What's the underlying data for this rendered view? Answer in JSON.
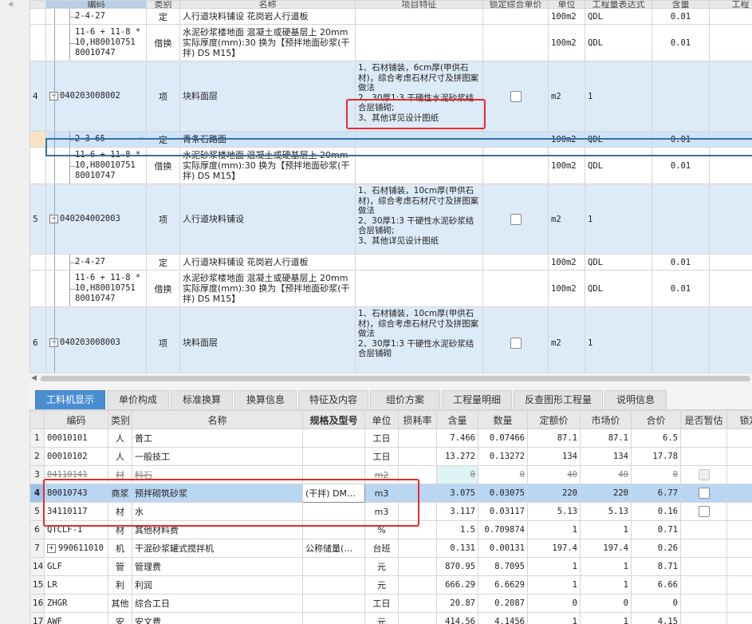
{
  "left_bar": {
    "collapse_icon": "«"
  },
  "top_grid": {
    "headers": [
      "编码",
      "类别",
      "名称",
      "项目特征",
      "锁定综合单价",
      "单位",
      "工程量表达式",
      "含量",
      "工程"
    ],
    "rows": [
      {
        "row": "",
        "code": "2-4-27",
        "type": "定",
        "name": "人行道块料铺设 花岗岩人行道板",
        "feature": "",
        "unit": "100m2",
        "expr": "QDL",
        "qty": "0.01",
        "kind": "child"
      },
      {
        "row": "",
        "code": "11-6 + 11-8 * 10,H80010751 80010747",
        "type": "借换",
        "name": "水泥砂浆楼地面 混凝土或硬基层上 20mm 实际厚度(mm):30 换为【预拌地面砂浆(干拌) DS M15】",
        "feature": "",
        "unit": "100m2",
        "expr": "QDL",
        "qty": "0.01",
        "kind": "child"
      },
      {
        "row": "4",
        "code": "040203008002",
        "type": "项",
        "name": "块料面层",
        "feature": "1、石材铺装，6cm厚(甲供石材)，综合考虑石材尺寸及拼图案做法\n2、30厚1:3 干硬性水泥砂浆结合层铺砌;\n3、其他详见设计图纸",
        "unit": "m2",
        "expr": "1",
        "qty": "",
        "kind": "item"
      },
      {
        "row": "",
        "code": "2-3-65",
        "type": "定",
        "name": "青条石路面",
        "feature": "",
        "unit": "100m2",
        "expr": "QDL",
        "qty": "0.01",
        "kind": "current"
      },
      {
        "row": "",
        "code": "11-6 + 11-8 * 10,H80010751 80010747",
        "type": "借换",
        "name": "水泥砂浆楼地面 混凝土或硬基层上 20mm 实际厚度(mm):30 换为【预拌地面砂浆(干拌) DS M15】",
        "feature": "",
        "unit": "100m2",
        "expr": "QDL",
        "qty": "0.01",
        "kind": "child"
      },
      {
        "row": "5",
        "code": "040204002003",
        "type": "项",
        "name": "人行道块料铺设",
        "feature": "1、石材铺装，10cm厚(甲供石材)，综合考虑石材尺寸及拼图案做法\n2、30厚1:3 干硬性水泥砂浆结合层铺砌;\n3、其他详见设计图纸",
        "unit": "m2",
        "expr": "1",
        "qty": "",
        "kind": "item"
      },
      {
        "row": "",
        "code": "2-4-27",
        "type": "定",
        "name": "人行道块料铺设 花岗岩人行道板",
        "feature": "",
        "unit": "100m2",
        "expr": "QDL",
        "qty": "0.01",
        "kind": "child"
      },
      {
        "row": "",
        "code": "11-6 + 11-8 * 10,H80010751 80010747",
        "type": "借换",
        "name": "水泥砂浆楼地面 混凝土或硬基层上 20mm 实际厚度(mm):30 换为【预拌地面砂浆(干拌) DS M15】",
        "feature": "",
        "unit": "100m2",
        "expr": "QDL",
        "qty": "0.01",
        "kind": "child"
      },
      {
        "row": "6",
        "code": "040203008003",
        "type": "项",
        "name": "块料面层",
        "feature": "1、石材铺装，10cm厚(甲供石材)，综合考虑石材尺寸及拼图案做法\n2、30厚1:3 干硬性水泥砂浆结合层铺砌",
        "unit": "m2",
        "expr": "1",
        "qty": "",
        "kind": "item"
      }
    ]
  },
  "tabs": [
    "工料机显示",
    "单价构成",
    "标准换算",
    "换算信息",
    "特征及内容",
    "组价方案",
    "工程量明细",
    "反查图形工程量",
    "说明信息"
  ],
  "bottom_grid": {
    "headers": [
      "",
      "编码",
      "类别",
      "名称",
      "规格及型号",
      "单位",
      "损耗率",
      "含量",
      "数量",
      "定额价",
      "市场价",
      "合价",
      "是否暂估",
      "锁定"
    ],
    "rows": [
      {
        "n": "1",
        "code": "00010101",
        "type": "人",
        "name": "普工",
        "spec": "",
        "unit": "工日",
        "loss": "",
        "content": "7.466",
        "count": "0.07466",
        "base": "87.1",
        "market": "87.1",
        "total": "6.5",
        "est": ""
      },
      {
        "n": "2",
        "code": "00010102",
        "type": "人",
        "name": "一般技工",
        "spec": "",
        "unit": "工日",
        "loss": "",
        "content": "13.272",
        "count": "0.13272",
        "base": "134",
        "market": "134",
        "total": "17.78",
        "est": ""
      },
      {
        "n": "3",
        "code": "04110141",
        "type": "材",
        "name": "料石",
        "spec": "",
        "unit": "m2",
        "loss": "",
        "content": "0",
        "count": "0",
        "base": "40",
        "market": "40",
        "total": "0",
        "est": "disabled"
      },
      {
        "n": "4",
        "code": "80010743",
        "type": "商浆",
        "name": "预拌砌筑砂浆",
        "spec": "(干拌) DM…",
        "unit": "m3",
        "loss": "",
        "content": "3.075",
        "count": "0.03075",
        "base": "220",
        "market": "220",
        "total": "6.77",
        "est": "box"
      },
      {
        "n": "5",
        "code": "34110117",
        "type": "材",
        "name": "水",
        "spec": "",
        "unit": "m3",
        "loss": "",
        "content": "3.117",
        "count": "0.03117",
        "base": "5.13",
        "market": "5.13",
        "total": "0.16",
        "est": "box"
      },
      {
        "n": "6",
        "code": "QTCLF-1",
        "type": "材",
        "name": "其他材料费",
        "spec": "",
        "unit": "%",
        "loss": "",
        "content": "1.5",
        "count": "0.709874",
        "base": "1",
        "market": "1",
        "total": "0.71",
        "est": ""
      },
      {
        "n": "7",
        "code": "990611010",
        "type": "机",
        "name": "干混砂浆罐式搅拌机",
        "spec": "公称储量(…",
        "unit": "台班",
        "loss": "",
        "content": "0.131",
        "count": "0.00131",
        "base": "197.4",
        "market": "197.4",
        "total": "0.26",
        "est": ""
      },
      {
        "n": "14",
        "code": "GLF",
        "type": "管",
        "name": "管理费",
        "spec": "",
        "unit": "元",
        "loss": "",
        "content": "870.95",
        "count": "8.7095",
        "base": "1",
        "market": "1",
        "total": "8.71",
        "est": ""
      },
      {
        "n": "15",
        "code": "LR",
        "type": "利",
        "name": "利润",
        "spec": "",
        "unit": "元",
        "loss": "",
        "content": "666.29",
        "count": "6.6629",
        "base": "1",
        "market": "1",
        "total": "6.66",
        "est": ""
      },
      {
        "n": "16",
        "code": "ZHGR",
        "type": "其他",
        "name": "综合工日",
        "spec": "",
        "unit": "工日",
        "loss": "",
        "content": "20.87",
        "count": "0.2087",
        "base": "0",
        "market": "0",
        "total": "0",
        "est": ""
      },
      {
        "n": "17",
        "code": "AWF",
        "type": "安",
        "name": "安文费",
        "spec": "",
        "unit": "元",
        "loss": "",
        "content": "414.56",
        "count": "4.1456",
        "base": "1",
        "market": "1",
        "total": "4.15",
        "est": ""
      }
    ]
  },
  "ellipsis_icon": "⋯",
  "minus_icon": "−",
  "plus_icon": "+",
  "colors": {
    "accent": "#4a8ed1",
    "highlight": "#e52b2b",
    "selected_row": "#b9d6f3"
  }
}
